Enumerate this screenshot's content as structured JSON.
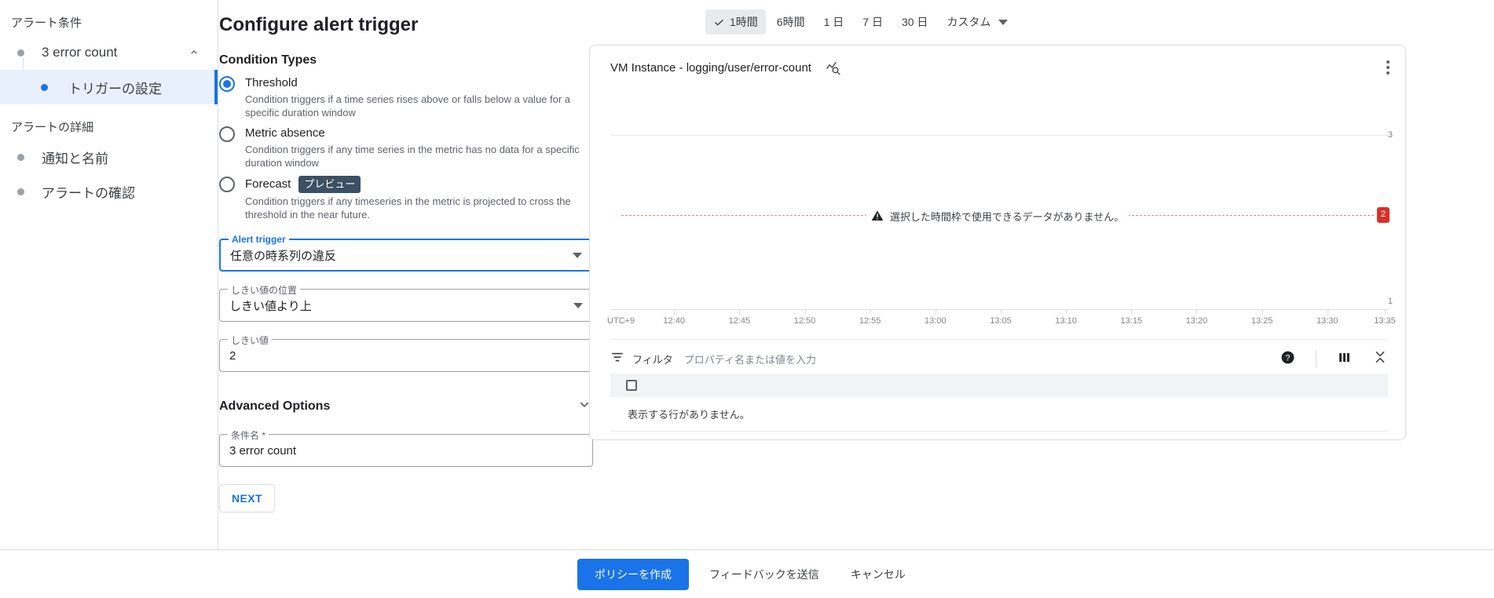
{
  "sidebar": {
    "groups": [
      {
        "title": "アラート条件",
        "items": [
          {
            "label": "3 error count",
            "collapse_icon": "chevron-up-icon"
          }
        ],
        "children": [
          {
            "label": "トリガーの設定"
          }
        ]
      },
      {
        "title": "アラートの詳細",
        "items": [
          {
            "label": "通知と名前"
          },
          {
            "label": "アラートの確認"
          }
        ]
      }
    ]
  },
  "form": {
    "page_title": "Configure alert trigger",
    "condition_types_heading": "Condition Types",
    "options": [
      {
        "label": "Threshold",
        "selected": true,
        "description": "Condition triggers if a time series rises above or falls below a value for a specific duration window"
      },
      {
        "label": "Metric absence",
        "selected": false,
        "description": "Condition triggers if any time series in the metric has no data for a specific duration window"
      },
      {
        "label": "Forecast",
        "selected": false,
        "badge": "プレビュー",
        "description": "Condition triggers if any timeseries in the metric is projected to cross the threshold in the near future."
      }
    ],
    "fields": [
      {
        "label": "Alert trigger",
        "value": "任意の時系列の違反",
        "type": "select",
        "focused": true
      },
      {
        "label": "しきい値の位置",
        "value": "しきい値より上",
        "type": "select",
        "focused": false
      },
      {
        "label": "しきい値",
        "value": "2",
        "type": "text",
        "focused": false
      }
    ],
    "advanced_options_label": "Advanced Options",
    "advanced_icon": "chevron-down-icon",
    "condition_name": {
      "label": "条件名 *",
      "value": "3 error count"
    },
    "next_label": "NEXT"
  },
  "timerange": {
    "options": [
      "1時間",
      "6時間",
      "1 日",
      "7 日",
      "30 日"
    ],
    "selected": "1時間",
    "custom_label": "カスタム",
    "custom_icon": "chevron-down-icon",
    "check_icon": "check-icon"
  },
  "chart": {
    "title": "VM Instance - logging/user/error-count",
    "explore_icon": "chart-explore-icon",
    "menu_icon": "more-vert-icon",
    "warning_icon": "warning-icon",
    "no_data_message": "選択した時間枠で使用できるデータがありません。",
    "threshold_badge": "2",
    "timezone_label": "UTC+9"
  },
  "chart_data": {
    "type": "line",
    "title": "VM Instance - logging/user/error-count",
    "xlabel": "UTC+9",
    "ylabel": "",
    "x": [
      "12:40",
      "12:45",
      "12:50",
      "12:55",
      "13:00",
      "13:05",
      "13:10",
      "13:15",
      "13:20",
      "13:25",
      "13:30",
      "13:35"
    ],
    "series": [],
    "ytick_labels": [
      "3",
      "1"
    ],
    "ylim": [
      1,
      3
    ],
    "threshold_line": {
      "value": 2,
      "label": "2",
      "color": "#e8837f",
      "style": "dashed"
    },
    "annotation": "選択した時間枠で使用できるデータがありません。",
    "grid": true,
    "legend": "none"
  },
  "filterbar": {
    "icon": "filter-icon",
    "label": "フィルタ",
    "placeholder": "プロパティ名または値を入力",
    "help_icon": "help-icon",
    "columns_icon": "column-settings-icon",
    "collapse_icon": "collapse-icon"
  },
  "table": {
    "empty_message": "表示する行がありません。"
  },
  "footer": {
    "primary_label": "ポリシーを作成",
    "feedback_label": "フィードバックを送信",
    "cancel_label": "キャンセル"
  }
}
